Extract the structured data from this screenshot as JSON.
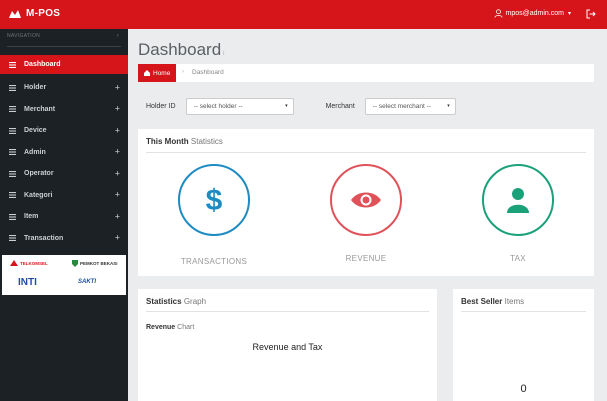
{
  "app": {
    "brand": "M-POS"
  },
  "topbar": {
    "user_email": "mpos@admin.com",
    "user_caret": "▾"
  },
  "sidebar": {
    "header": "NAVIGATION",
    "items": [
      {
        "label": "Dashboard",
        "active": true,
        "expandable": false
      },
      {
        "label": "Holder",
        "expandable": true
      },
      {
        "label": "Merchant",
        "expandable": true
      },
      {
        "label": "Device",
        "expandable": true
      },
      {
        "label": "Admin",
        "expandable": true
      },
      {
        "label": "Operator",
        "expandable": true
      },
      {
        "label": "Kategori",
        "expandable": true
      },
      {
        "label": "Item",
        "expandable": true
      },
      {
        "label": "Transaction",
        "expandable": true
      }
    ],
    "plus": "+",
    "partners": [
      "TELKOMSEL",
      "PEMKOT BEKASI",
      "INTI",
      "SAKTI"
    ]
  },
  "page": {
    "title": "Dashboard",
    "title_small": "i"
  },
  "breadcrumb": {
    "home": "Home",
    "separator": "›",
    "current": "Dashboard"
  },
  "filters": {
    "holder_label": "Holder ID",
    "holder_value": "-- select holder --",
    "merchant_label": "Merchant",
    "merchant_value": "-- select merchant --",
    "dropdown_glyph": "▾"
  },
  "stats": {
    "title_bold": "This Month",
    "title_light": "Statistics",
    "items": [
      {
        "label": "TRANSACTIONS",
        "icon": "dollar-icon",
        "color": "#1e8bc3"
      },
      {
        "label": "REVENUE",
        "icon": "eye-icon",
        "color": "#e0525a"
      },
      {
        "label": "TAX",
        "icon": "user-icon",
        "color": "#1aa17a"
      }
    ]
  },
  "graph": {
    "title_bold": "Statistics",
    "title_light": "Graph",
    "sub_bold": "Revenue",
    "sub_light": "Chart",
    "chart_title": "Revenue and Tax"
  },
  "bestseller": {
    "title_bold": "Best Seller",
    "title_light": "Items",
    "count": "0"
  },
  "colors": {
    "accent": "#d6151b",
    "sidebar": "#1b2124",
    "background": "#eaecee"
  }
}
